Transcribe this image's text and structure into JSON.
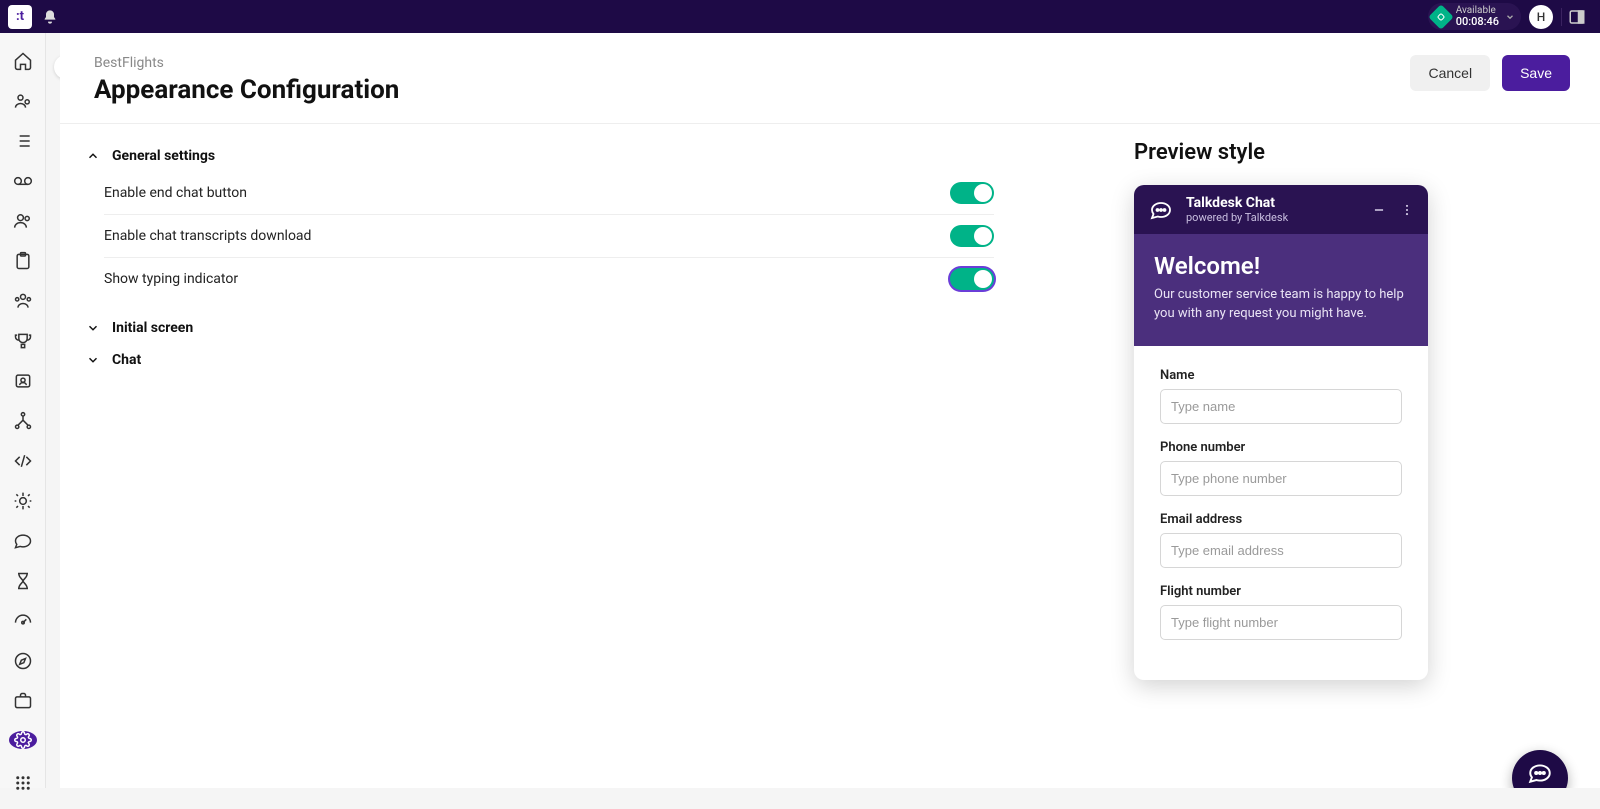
{
  "topbar": {
    "status_label": "Available",
    "status_time": "00:08:46",
    "avatar_initial": "H"
  },
  "header": {
    "breadcrumb": "BestFlights",
    "title": "Appearance Configuration",
    "cancel_label": "Cancel",
    "save_label": "Save"
  },
  "sections": {
    "general": {
      "title": "General settings",
      "rows": [
        {
          "label": "Enable end chat button",
          "on": true
        },
        {
          "label": "Enable chat transcripts download",
          "on": true
        },
        {
          "label": "Show typing indicator",
          "on": true,
          "focused": true
        }
      ]
    },
    "initial": {
      "title": "Initial screen"
    },
    "chat": {
      "title": "Chat"
    }
  },
  "preview": {
    "title": "Preview style",
    "widget": {
      "header_title": "Talkdesk Chat",
      "header_sub": "powered by Talkdesk",
      "welcome_title": "Welcome!",
      "welcome_body": "Our customer service team is happy to help you with any request you might have.",
      "fields": [
        {
          "label": "Name",
          "placeholder": "Type name"
        },
        {
          "label": "Phone number",
          "placeholder": "Type phone number"
        },
        {
          "label": "Email address",
          "placeholder": "Type email address"
        },
        {
          "label": "Flight number",
          "placeholder": "Type flight number"
        }
      ]
    }
  }
}
